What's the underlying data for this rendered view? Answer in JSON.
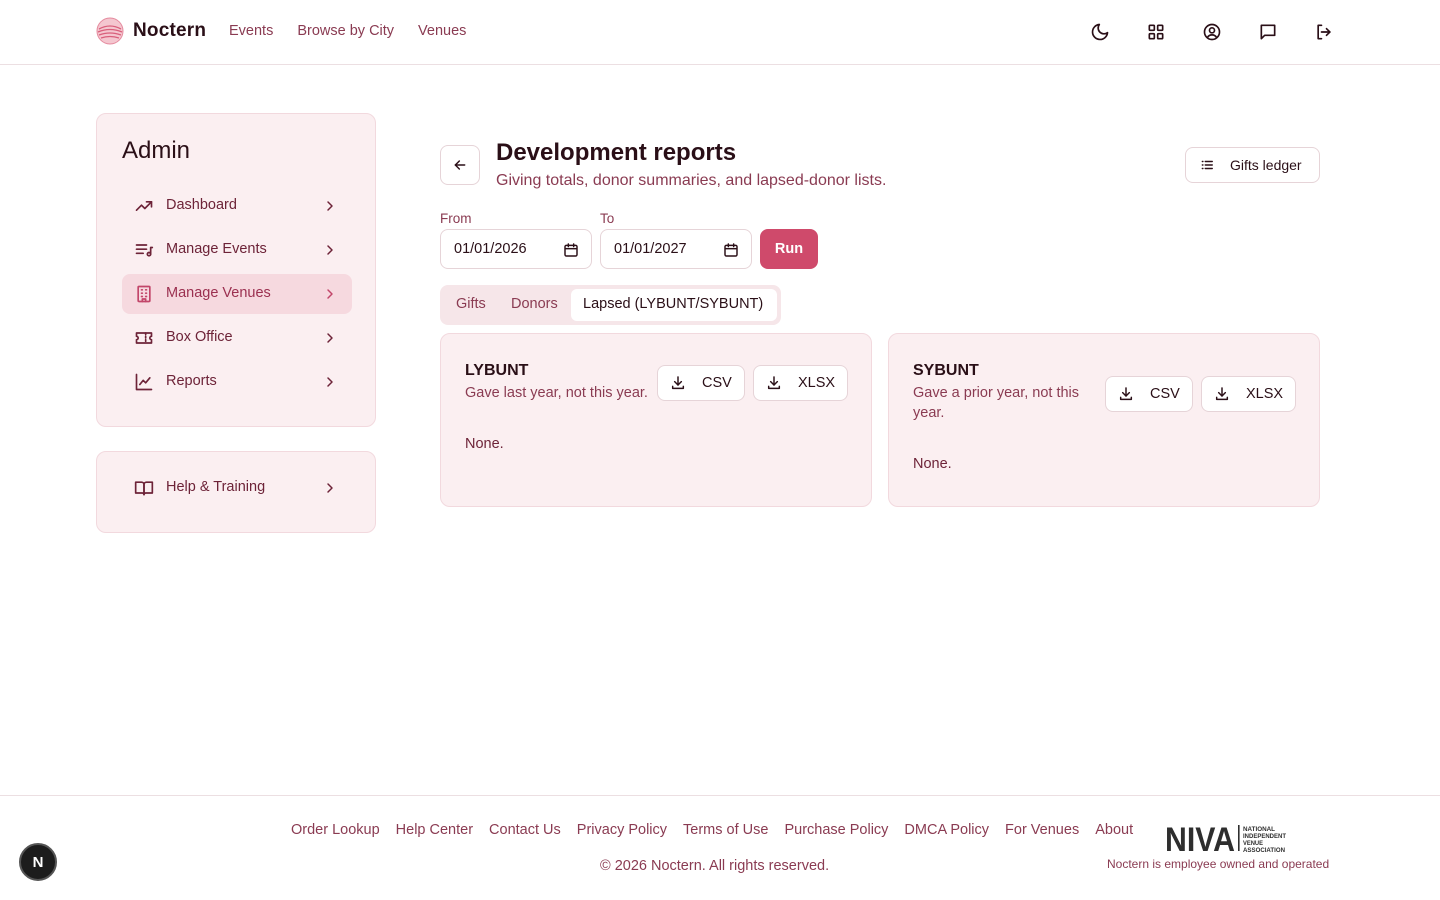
{
  "header": {
    "brand": "Noctern",
    "nav": [
      "Events",
      "Browse by City",
      "Venues"
    ],
    "icons": [
      "moon-icon",
      "grid-icon",
      "user-circle-icon",
      "message-icon",
      "logout-icon"
    ]
  },
  "sidebar": {
    "title": "Admin",
    "items": [
      {
        "label": "Dashboard",
        "icon": "trending-up-icon"
      },
      {
        "label": "Manage Events",
        "icon": "list-music-icon"
      },
      {
        "label": "Manage Venues",
        "icon": "building-icon",
        "active": true
      },
      {
        "label": "Box Office",
        "icon": "ticket-icon"
      },
      {
        "label": "Reports",
        "icon": "line-chart-icon"
      }
    ],
    "help": {
      "label": "Help & Training",
      "icon": "book-icon"
    }
  },
  "main": {
    "title": "Development reports",
    "subtitle": "Giving totals, donor summaries, and lapsed-donor lists.",
    "ledger_button": "Gifts ledger",
    "from_label": "From",
    "from_value": "01/01/2026",
    "to_label": "To",
    "to_value": "01/01/2027",
    "run_button": "Run",
    "tabs": [
      {
        "label": "Gifts"
      },
      {
        "label": "Donors"
      },
      {
        "label": "Lapsed (LYBUNT/SYBUNT)",
        "active": true
      }
    ],
    "cards": [
      {
        "title": "LYBUNT",
        "description": "Gave last year, not this year.",
        "csv": "CSV",
        "xlsx": "XLSX",
        "empty": "None."
      },
      {
        "title": "SYBUNT",
        "description": "Gave a prior year, not this year.",
        "csv": "CSV",
        "xlsx": "XLSX",
        "empty": "None."
      }
    ]
  },
  "footer": {
    "links": [
      "Order Lookup",
      "Help Center",
      "Contact Us",
      "Privacy Policy",
      "Terms of Use",
      "Purchase Policy",
      "DMCA Policy",
      "For Venues",
      "About"
    ],
    "copyright": "© 2026 Noctern. All rights reserved.",
    "niva_logo": "NIVA",
    "niva_sub": [
      "NATIONAL",
      "INDEPENDENT",
      "VENUE",
      "ASSOCIATION"
    ],
    "niva_tagline": "Noctern is employee owned and operated",
    "badge": "N"
  },
  "colors": {
    "accent": "#cf4a6b",
    "text_muted": "#8a3b52",
    "card_bg": "#fbeff1"
  }
}
